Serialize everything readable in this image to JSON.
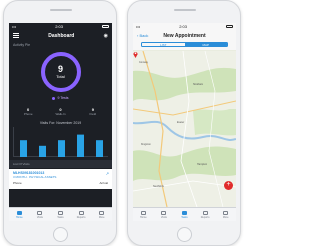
{
  "colors": {
    "accent": "#2a8dd8",
    "donut": "#8a63ff",
    "bars": "#29a3e6",
    "fab": "#e02b2b",
    "pin": "#e02b2b"
  },
  "left_phone": {
    "status": {
      "time": "2:03",
      "signal": "•••"
    },
    "navbar": {
      "title": "Dashboard",
      "menu_icon": "hamburger-icon",
      "bell_icon": "bell-icon"
    },
    "section_label": "Activity Pie",
    "donut": {
      "value": "9",
      "label": "Total",
      "fill_fraction": 1.0
    },
    "legend": {
      "label": "9 Tests"
    },
    "stats": [
      {
        "icon": "phone-icon",
        "value": "0",
        "label": "Phone"
      },
      {
        "icon": "walkin-icon",
        "value": "0",
        "label": "Walk-In"
      },
      {
        "icon": "field-icon",
        "value": "9",
        "label": "Field"
      }
    ],
    "chart_data": {
      "type": "bar",
      "title": "Visits For: November 2019",
      "categories": [
        "",
        "",
        "",
        "",
        ""
      ],
      "values": [
        3,
        2,
        3,
        4,
        3
      ],
      "ylim": [
        0,
        5
      ],
      "grid": false
    },
    "list_header": "List Of Visits",
    "card": {
      "id": "MLHS09181001013",
      "description": "3 MONTH · PHYSICAL ASSETS",
      "left_label": "Phone",
      "left_value": "",
      "right_label": "Arrival",
      "right_value": ""
    },
    "tabs": [
      {
        "label": "Home",
        "icon": "home-icon"
      },
      {
        "label": "Visits",
        "icon": "calendar-icon"
      },
      {
        "label": "Tasks",
        "icon": "checklist-icon"
      },
      {
        "label": "Reports",
        "icon": "chart-icon"
      },
      {
        "label": "More",
        "icon": "more-icon"
      }
    ],
    "active_tab": 0
  },
  "right_phone": {
    "status": {
      "time": "2:03",
      "signal": "•••"
    },
    "navbar": {
      "back": "‹ Back",
      "title": "New Appointment"
    },
    "segment": {
      "options": [
        "LIST",
        "MAP"
      ],
      "selected": "MAP"
    },
    "map_labels": [
      "Conway",
      "Stratham",
      "Exeter",
      "Kingston",
      "Hampton",
      "Newfields"
    ],
    "pin_icon": "map-pin-icon",
    "fab": {
      "label": "+",
      "icon": "plus-icon"
    },
    "tabs": [
      {
        "label": "Home",
        "icon": "home-icon"
      },
      {
        "label": "Visits",
        "icon": "calendar-icon"
      },
      {
        "label": "Tasks",
        "icon": "checklist-icon"
      },
      {
        "label": "Reports",
        "icon": "chart-icon"
      },
      {
        "label": "More",
        "icon": "more-icon"
      }
    ],
    "active_tab": 2
  }
}
